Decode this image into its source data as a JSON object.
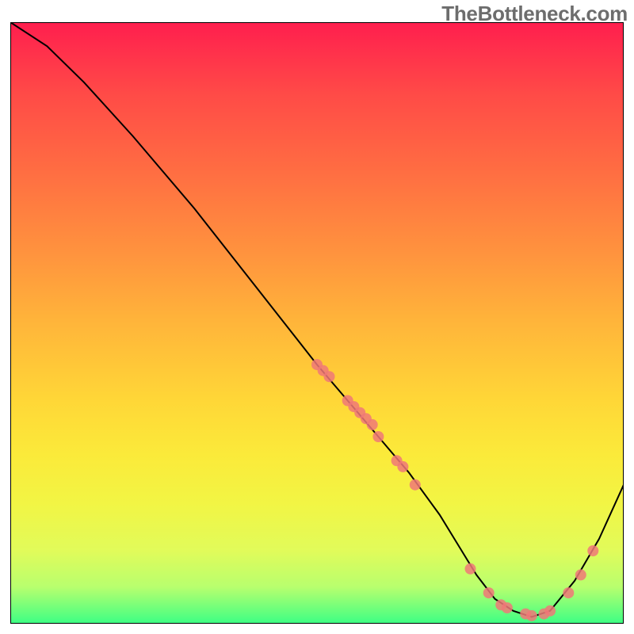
{
  "watermark": "TheBottleneck.com",
  "chart_data": {
    "type": "line",
    "title": "",
    "xlabel": "",
    "ylabel": "",
    "xlim": [
      0,
      100
    ],
    "ylim": [
      0,
      100
    ],
    "grid": false,
    "series": [
      {
        "name": "curve",
        "x": [
          0,
          6,
          12,
          20,
          30,
          40,
          50,
          55,
          60,
          65,
          70,
          73,
          76,
          79,
          82,
          85,
          88,
          92,
          96,
          100
        ],
        "values": [
          100,
          96,
          90,
          81,
          69,
          56,
          43,
          37,
          31,
          25,
          18,
          13,
          8,
          4,
          2,
          1,
          2,
          7,
          14,
          23
        ]
      }
    ],
    "points": {
      "name": "markers",
      "color": "#f07878",
      "x": [
        50,
        51,
        52,
        55,
        56,
        57,
        58,
        59,
        60,
        63,
        64,
        66,
        75,
        78,
        80,
        81,
        84,
        85,
        87,
        88,
        91,
        93,
        95
      ],
      "values": [
        43,
        42,
        41,
        37,
        36,
        35,
        34,
        33,
        31,
        27,
        26,
        23,
        9,
        5,
        3,
        2.5,
        1.5,
        1.2,
        1.5,
        2,
        5,
        8,
        12
      ]
    }
  }
}
